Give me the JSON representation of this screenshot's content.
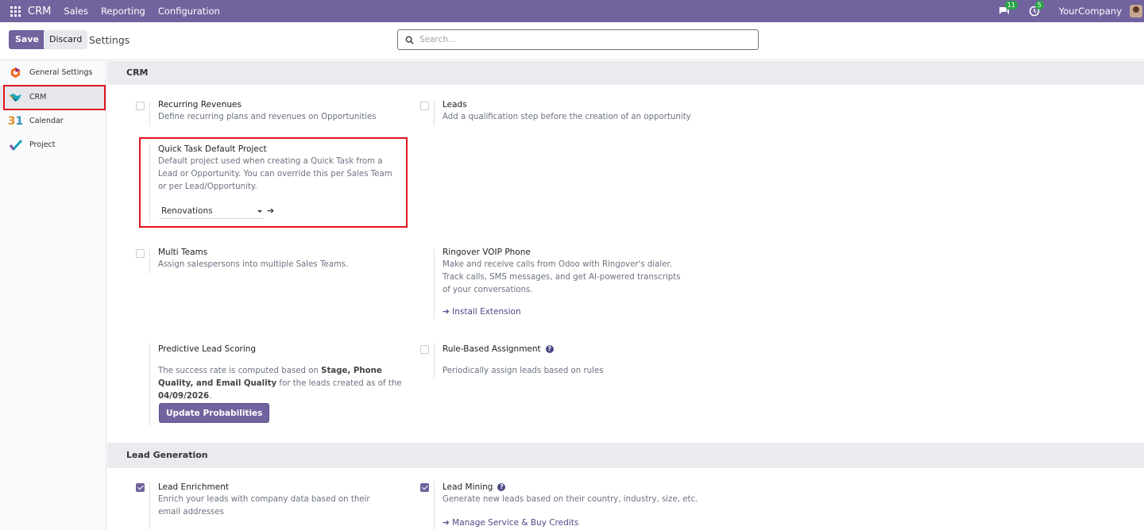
{
  "navbar": {
    "app_name": "CRM",
    "menu": [
      "Sales",
      "Reporting",
      "Configuration"
    ],
    "messages_count": "11",
    "activities_count": "5",
    "company": "YourCompany"
  },
  "control_panel": {
    "save_label": "Save",
    "discard_label": "Discard",
    "title": "Settings",
    "search_placeholder": "Search..."
  },
  "sidebar": {
    "items": [
      {
        "label": "General Settings",
        "icon": "settings-logo-icon"
      },
      {
        "label": "CRM",
        "icon": "crm-handshake-icon"
      },
      {
        "label": "Calendar",
        "icon": "calendar-31-icon"
      },
      {
        "label": "Project",
        "icon": "project-check-icon"
      }
    ],
    "active": "CRM"
  },
  "sections": {
    "crm": {
      "header": "CRM",
      "recurring_revenues": {
        "title": "Recurring Revenues",
        "desc": "Define recurring plans and revenues on Opportunities",
        "checked": false
      },
      "leads": {
        "title": "Leads",
        "desc": "Add a qualification step before the creation of an opportunity",
        "checked": false
      },
      "quick_task": {
        "title": "Quick Task Default Project",
        "desc": "Default project used when creating a Quick Task from a Lead or Opportunity. You can override this per Sales Team or per Lead/Opportunity.",
        "value": "Renovations",
        "arrow": "➔"
      },
      "multi_teams": {
        "title": "Multi Teams",
        "desc": "Assign salespersons into multiple Sales Teams.",
        "checked": false
      },
      "ringover": {
        "title": "Ringover VOIP Phone",
        "desc": "Make and receive calls from Odoo with Ringover's dialer. Track calls, SMS messages, and get AI-powered transcripts of your conversations.",
        "link": "➔ Install Extension"
      },
      "predictive": {
        "title": "Predictive Lead Scoring",
        "desc_1": "The success rate is computed based on ",
        "desc_bold_1": "Stage, Phone Quality, and Email Quality",
        "desc_2": " for the leads created as of the ",
        "desc_bold_2": "04/09/2026",
        "desc_3": ".",
        "button": "Update Probabilities"
      },
      "rule_based": {
        "title": "Rule-Based Assignment",
        "desc": "Periodically assign leads based on rules",
        "checked": false,
        "help": "?"
      }
    },
    "lead_generation": {
      "header": "Lead Generation",
      "enrichment": {
        "title": "Lead Enrichment",
        "desc": "Enrich your leads with company data based on their email addresses",
        "checked": true
      },
      "mining": {
        "title": "Lead Mining",
        "desc": "Generate new leads based on their country, industry, size, etc.",
        "checked": true,
        "help": "?",
        "link": "➔ Manage Service & Buy Credits"
      }
    }
  },
  "colors": {
    "brand": "#71639e",
    "highlight": "#e0151f",
    "link": "#4c4a86"
  }
}
